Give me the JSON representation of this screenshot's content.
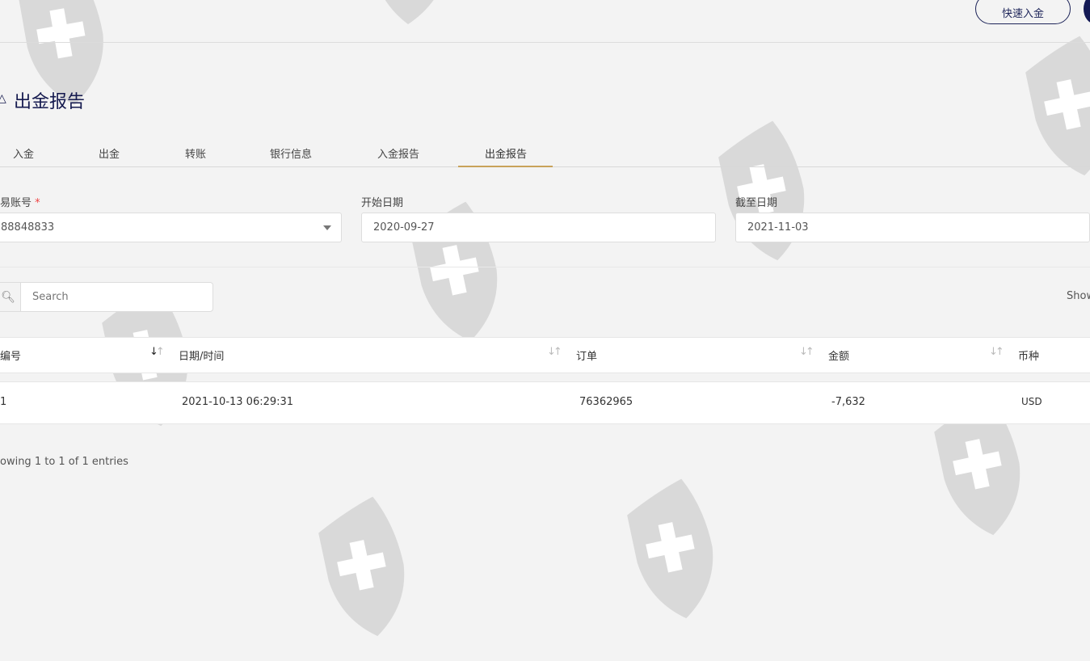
{
  "header": {
    "quick_deposit_label": "快速入金"
  },
  "page": {
    "title": "出金报告"
  },
  "tabs": [
    {
      "label": "入金",
      "active": false
    },
    {
      "label": "出金",
      "active": false
    },
    {
      "label": "转账",
      "active": false
    },
    {
      "label": "银行信息",
      "active": false
    },
    {
      "label": "入金报告",
      "active": false
    },
    {
      "label": "出金报告",
      "active": true
    }
  ],
  "filters": {
    "account": {
      "label": "易账号",
      "required_mark": "*",
      "value": "88848833"
    },
    "start_date": {
      "label": "开始日期",
      "value": "2020-09-27"
    },
    "end_date": {
      "label": "截至日期",
      "value": "2021-11-03"
    }
  },
  "search": {
    "placeholder": "Search"
  },
  "show_label": "Show",
  "table": {
    "columns": [
      "编号",
      "日期/时间",
      "订单",
      "金额",
      "币种"
    ],
    "rows": [
      {
        "id": "1",
        "datetime": "2021-10-13 06:29:31",
        "order": "76362965",
        "amount": "-7,632",
        "currency": "USD"
      }
    ]
  },
  "info": "owing 1 to 1 of 1 entries",
  "colors": {
    "accent": "#c8a25a",
    "brand": "#151a4f",
    "watermark": "#d9d9d9"
  }
}
